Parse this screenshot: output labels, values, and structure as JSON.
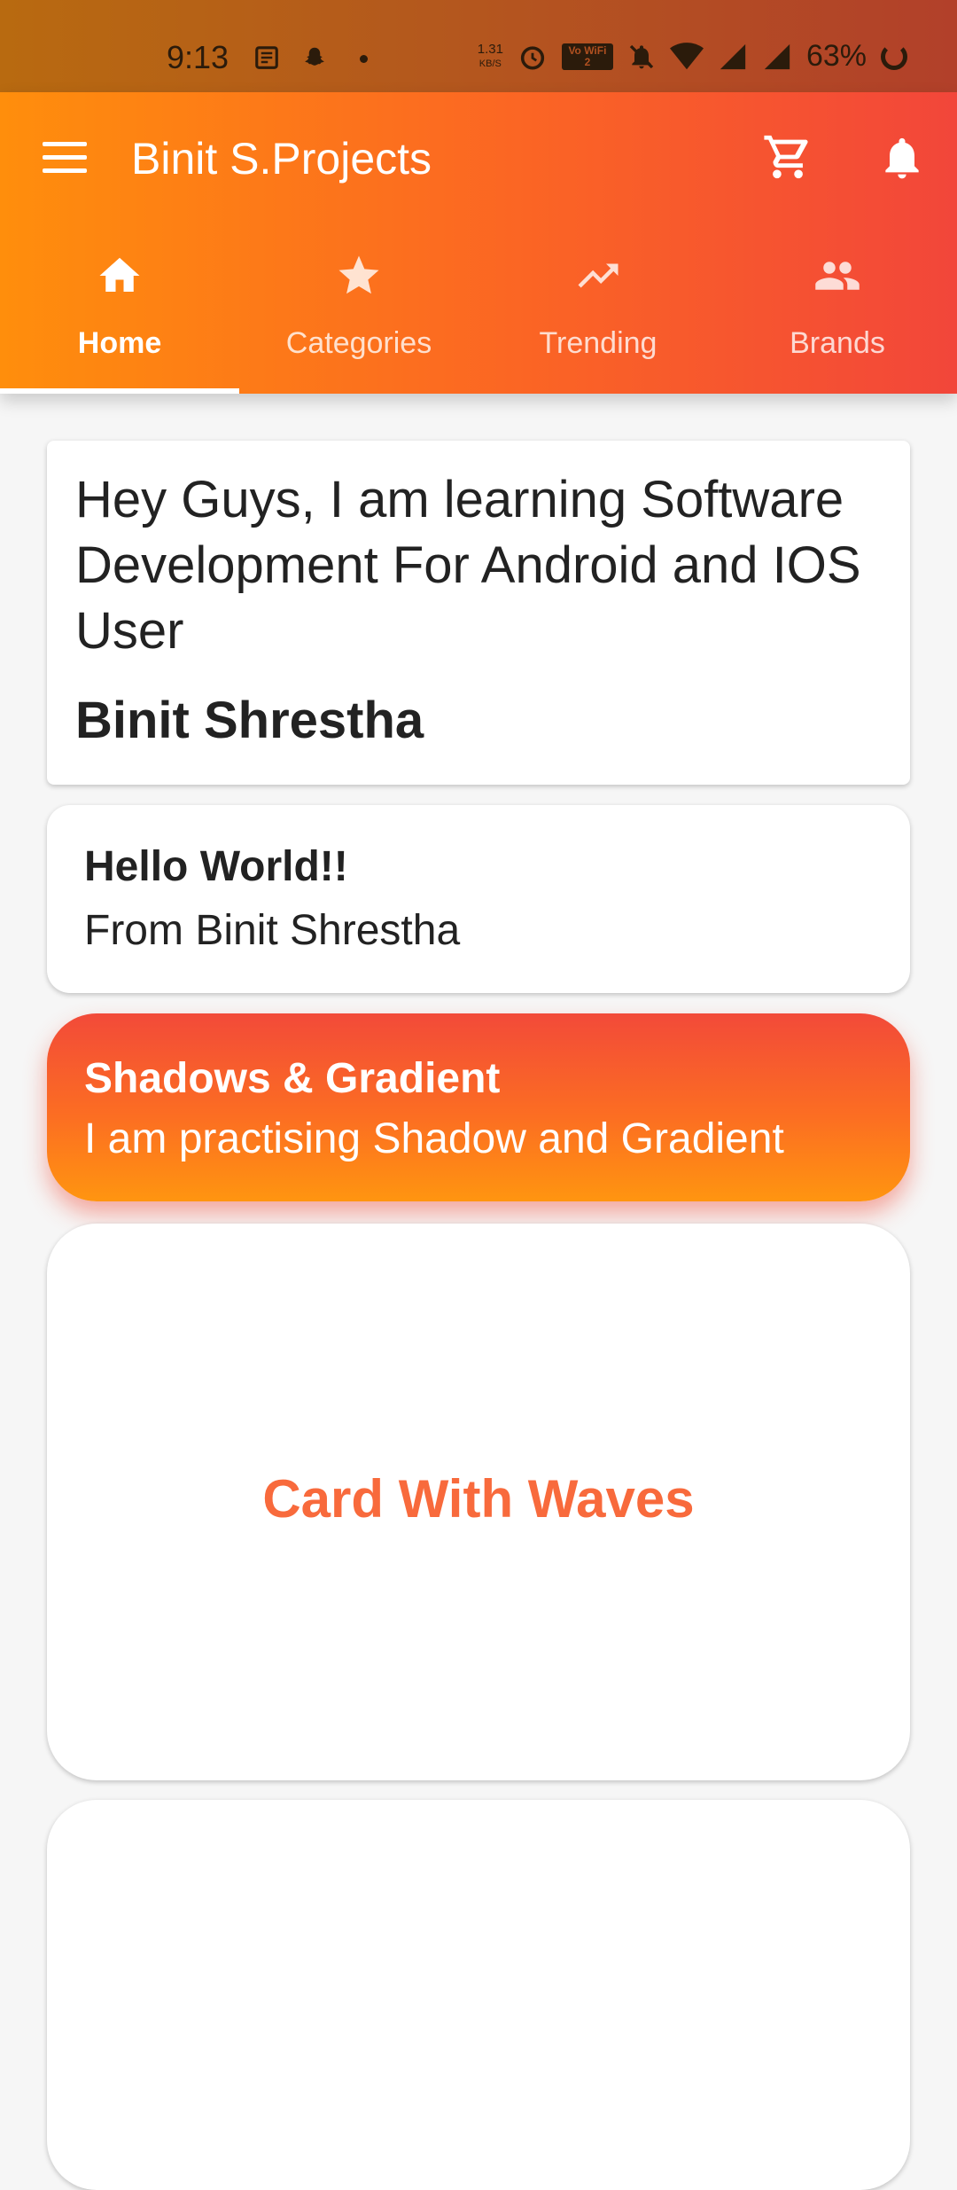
{
  "status_bar": {
    "time": "9:13",
    "speed": "1.31",
    "speed_unit": "KB/S",
    "wifi_badge": "Vo WiFi 2",
    "battery": "63%"
  },
  "app_bar": {
    "title": "Binit S.Projects",
    "icons": [
      "menu-icon",
      "cart-icon",
      "bell-icon"
    ]
  },
  "tabs": [
    {
      "label": "Home",
      "icon": "home-icon",
      "active": true
    },
    {
      "label": "Categories",
      "icon": "star-icon",
      "active": false
    },
    {
      "label": "Trending",
      "icon": "trending-up-icon",
      "active": false
    },
    {
      "label": "Brands",
      "icon": "people-icon",
      "active": false
    }
  ],
  "cards": {
    "intro": {
      "text": "Hey Guys, I am learning Software Development For Android and IOS User",
      "name": "Binit Shrestha"
    },
    "hello": {
      "title": "Hello World!!",
      "subtitle": "From Binit Shrestha"
    },
    "gradient": {
      "title": "Shadows & Gradient",
      "subtitle": "I am practising Shadow and Gradient"
    },
    "waves": {
      "title": "Card With Waves"
    }
  },
  "colors": {
    "accent_orange": "#ff8e0c",
    "accent_red": "#f2463a",
    "waves_text": "#f86a3c"
  }
}
